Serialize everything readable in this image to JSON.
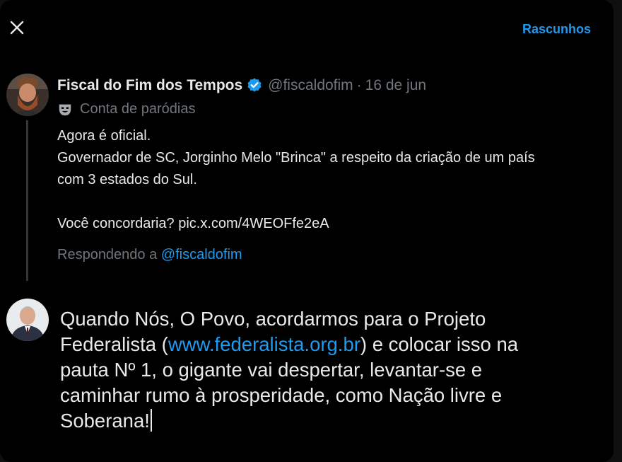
{
  "header": {
    "close_icon": "close-icon",
    "drafts_label": "Rascunhos"
  },
  "original_post": {
    "author_name": "Fiscal do Fim dos Tempos",
    "verified_icon": "verified-badge-icon",
    "handle": "@fiscaldofim",
    "separator": "·",
    "date": "16 de jun",
    "parody_icon": "parody-mask-icon",
    "parody_label": "Conta de paródias",
    "text_lines": [
      "Agora é oficial.",
      "Governador de SC, Jorginho Melo \"Brinca\" a respeito da criação de um país",
      "com 3 estados do Sul.",
      "",
      "Você concordaria? pic.x.com/4WEOFfe2eA"
    ],
    "replying_prefix": "Respondendo a ",
    "replying_handle": "@fiscaldofim"
  },
  "compose": {
    "line1": "Quando Nós, O Povo, acordarmos para o Projeto",
    "line2_before": "Federalista (",
    "line2_link": "www.federalista.org.br",
    "line2_after": ") e colocar isso na",
    "line3": "pauta Nº 1, o gigante vai despertar, levantar-se e",
    "line4": "caminhar rumo à prosperidade, como Nação livre e",
    "line5": "Soberana!"
  },
  "colors": {
    "background": "#000000",
    "accent": "#1d9bf0",
    "text_primary": "#e7e9ea",
    "text_secondary": "#71767b"
  }
}
